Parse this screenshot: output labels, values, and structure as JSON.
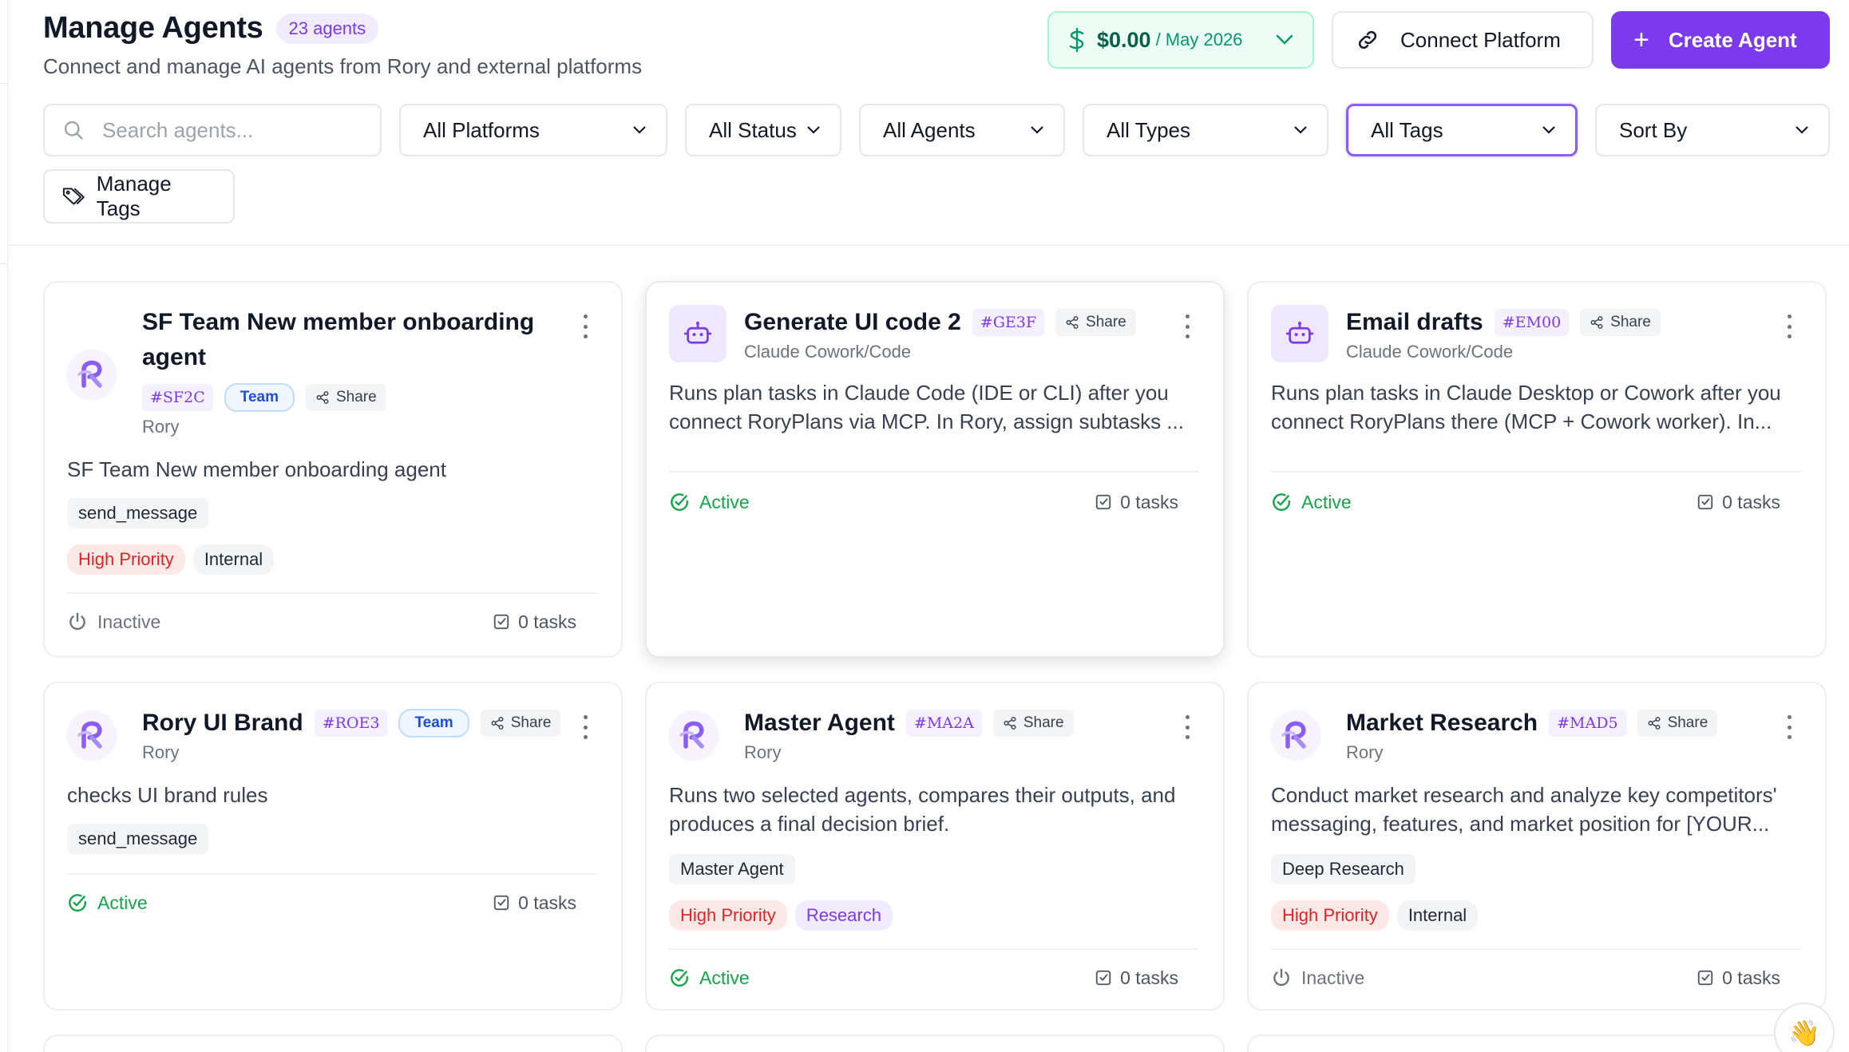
{
  "header": {
    "title": "Manage Agents",
    "count_badge": "23 agents",
    "subtitle": "Connect and manage AI agents from Rory and external platforms",
    "cost": {
      "amount": "$0.00",
      "period": "/ May 2026"
    },
    "connect_label": "Connect Platform",
    "create_label": "Create Agent"
  },
  "filters": {
    "search_placeholder": "Search agents...",
    "platforms": "All Platforms",
    "status": "All Status",
    "agents": "All Agents",
    "types": "All Types",
    "tags": "All Tags",
    "sort": "Sort By",
    "manage_tags": "Manage Tags"
  },
  "cards": [
    {
      "name_line1": "SF Team New member onboarding",
      "name_line2": "agent",
      "code": "#SF2C",
      "team": "Team",
      "share": "Share",
      "platform": "Rory",
      "description": "SF Team New member onboarding agent",
      "capabilities": [
        "send_message"
      ],
      "tags": [
        "High Priority",
        "Internal"
      ],
      "status": "Inactive",
      "tasks": "0 tasks"
    },
    {
      "name": "Generate UI code 2",
      "code": "#GE3F",
      "share": "Share",
      "platform": "Claude Cowork/Code",
      "description": "Runs plan tasks in Claude Code (IDE or CLI) after you connect RoryPlans via MCP. In Rory, assign subtasks ...",
      "status": "Active",
      "tasks": "0 tasks"
    },
    {
      "name": "Email drafts",
      "code": "#EM00",
      "share": "Share",
      "platform": "Claude Cowork/Code",
      "description": "Runs plan tasks in Claude Desktop or Cowork after you connect RoryPlans there (MCP + Cowork worker). In...",
      "status": "Active",
      "tasks": "0 tasks"
    },
    {
      "name": "Rory UI Brand",
      "code": "#ROE3",
      "team": "Team",
      "share": "Share",
      "platform": "Rory",
      "description": "checks UI brand rules",
      "capabilities": [
        "send_message"
      ],
      "status": "Active",
      "tasks": "0 tasks"
    },
    {
      "name": "Master Agent",
      "code": "#MA2A",
      "share": "Share",
      "platform": "Rory",
      "description": "Runs two selected agents, compares their outputs, and produces a final decision brief.",
      "capabilities": [
        "Master Agent"
      ],
      "tags": [
        "High Priority",
        "Research"
      ],
      "status": "Active",
      "tasks": "0 tasks"
    },
    {
      "name": "Market Research",
      "code": "#MAD5",
      "share": "Share",
      "platform": "Rory",
      "description": "Conduct market research and analyze key competitors' messaging, features, and market position for [YOUR...",
      "capabilities": [
        "Deep Research"
      ],
      "tags": [
        "High Priority",
        "Internal"
      ],
      "status": "Inactive",
      "tasks": "0 tasks"
    }
  ],
  "colors": {
    "accent": "#7c3aed",
    "active": "#16a34a",
    "inactive": "#6b7280",
    "high_priority": "#dc2626",
    "cost_green": "#047857"
  },
  "icons": [
    "search-icon",
    "chevron-down-icon",
    "dollar-icon",
    "link-icon",
    "plus-icon",
    "tag-icon",
    "rory-logo",
    "robot-icon",
    "share-icon",
    "more-vertical-icon",
    "check-circle-icon",
    "power-icon",
    "checkbox-icon",
    "wave-hand-icon"
  ]
}
